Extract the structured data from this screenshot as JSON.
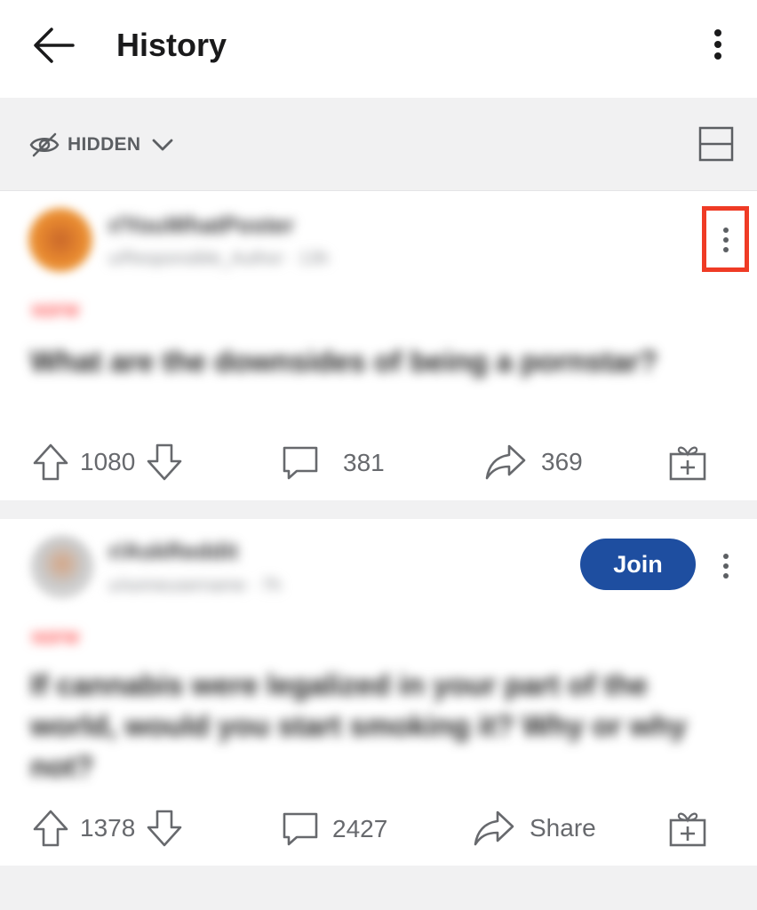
{
  "header": {
    "title": "History"
  },
  "filter": {
    "label": "HIDDEN"
  },
  "posts": [
    {
      "subreddit": "r/YouWhatPoster",
      "meta": "u/Responsible_Author · 13h",
      "flair": "NSFW",
      "title": "What are the downsides of being a pornstar?",
      "upvotes": "1080",
      "comments": "381",
      "shares": "369"
    },
    {
      "subreddit": "r/AskReddit",
      "meta": "u/someusername · 7h",
      "flair": "NSFW",
      "title": "If cannabis were legalized in your part of the world, would you start smoking it? Why or why not?",
      "upvotes": "1378",
      "comments": "2427",
      "share_label": "Share",
      "join_label": "Join"
    }
  ],
  "colors": {
    "accent_blue": "#1e4ea0",
    "highlight_red": "#ef3b25",
    "background": "#f1f1f2"
  }
}
